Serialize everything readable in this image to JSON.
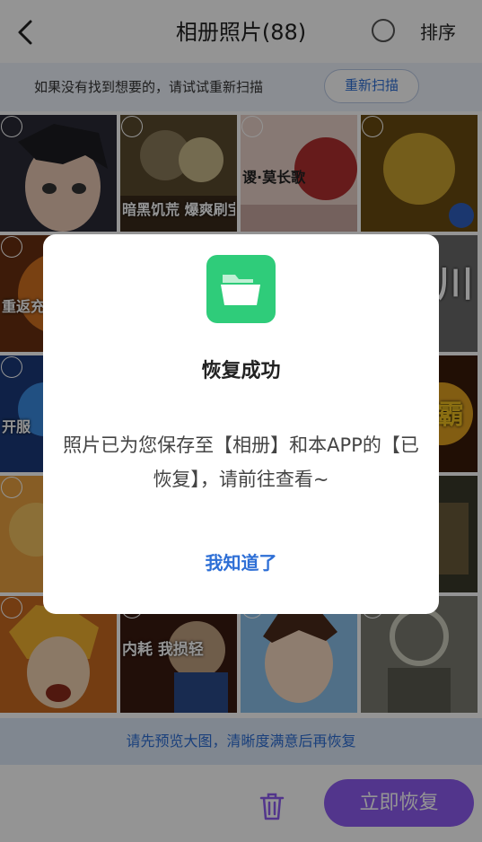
{
  "header": {
    "title": "相册照片(88)",
    "sort_label": "排序",
    "icons": {
      "back": "back-chevron-icon",
      "select_all": "select-all-circle-icon"
    }
  },
  "hint_bar": {
    "text": "如果没有找到想要的，请试试重新扫描",
    "rescan_label": "重新扫描"
  },
  "grid": {
    "cells": [
      {
        "text": ""
      },
      {
        "text": "暗黑饥荒 爆爽刷宝"
      },
      {
        "text": "谡·莫长歌"
      },
      {
        "text": ""
      },
      {
        "text": "重返充值"
      },
      {
        "text": ""
      },
      {
        "text": ""
      },
      {
        "text": "川"
      },
      {
        "text": "开服"
      },
      {
        "text": ""
      },
      {
        "text": ""
      },
      {
        "text": "霸"
      },
      {
        "text": ""
      },
      {
        "text": ""
      },
      {
        "text": ""
      },
      {
        "text": ""
      },
      {
        "text": ""
      },
      {
        "text": "内耗 我损轻"
      },
      {
        "text": ""
      },
      {
        "text": ""
      }
    ]
  },
  "bottom": {
    "tip": "请先预览大图，清晰度满意后再恢复",
    "restore_label": "立即恢复",
    "icons": {
      "delete": "trash-icon"
    }
  },
  "dialog": {
    "title": "恢复成功",
    "message": "照片已为您保存至【相册】和本APP的【已恢复】，请前往查看~",
    "confirm_label": "我知道了",
    "icon": "folder-icon"
  },
  "colors": {
    "accent_blue": "#2e6fd6",
    "restore_purple": "#8e5cf2",
    "folder_green": "#2fcc7a"
  }
}
